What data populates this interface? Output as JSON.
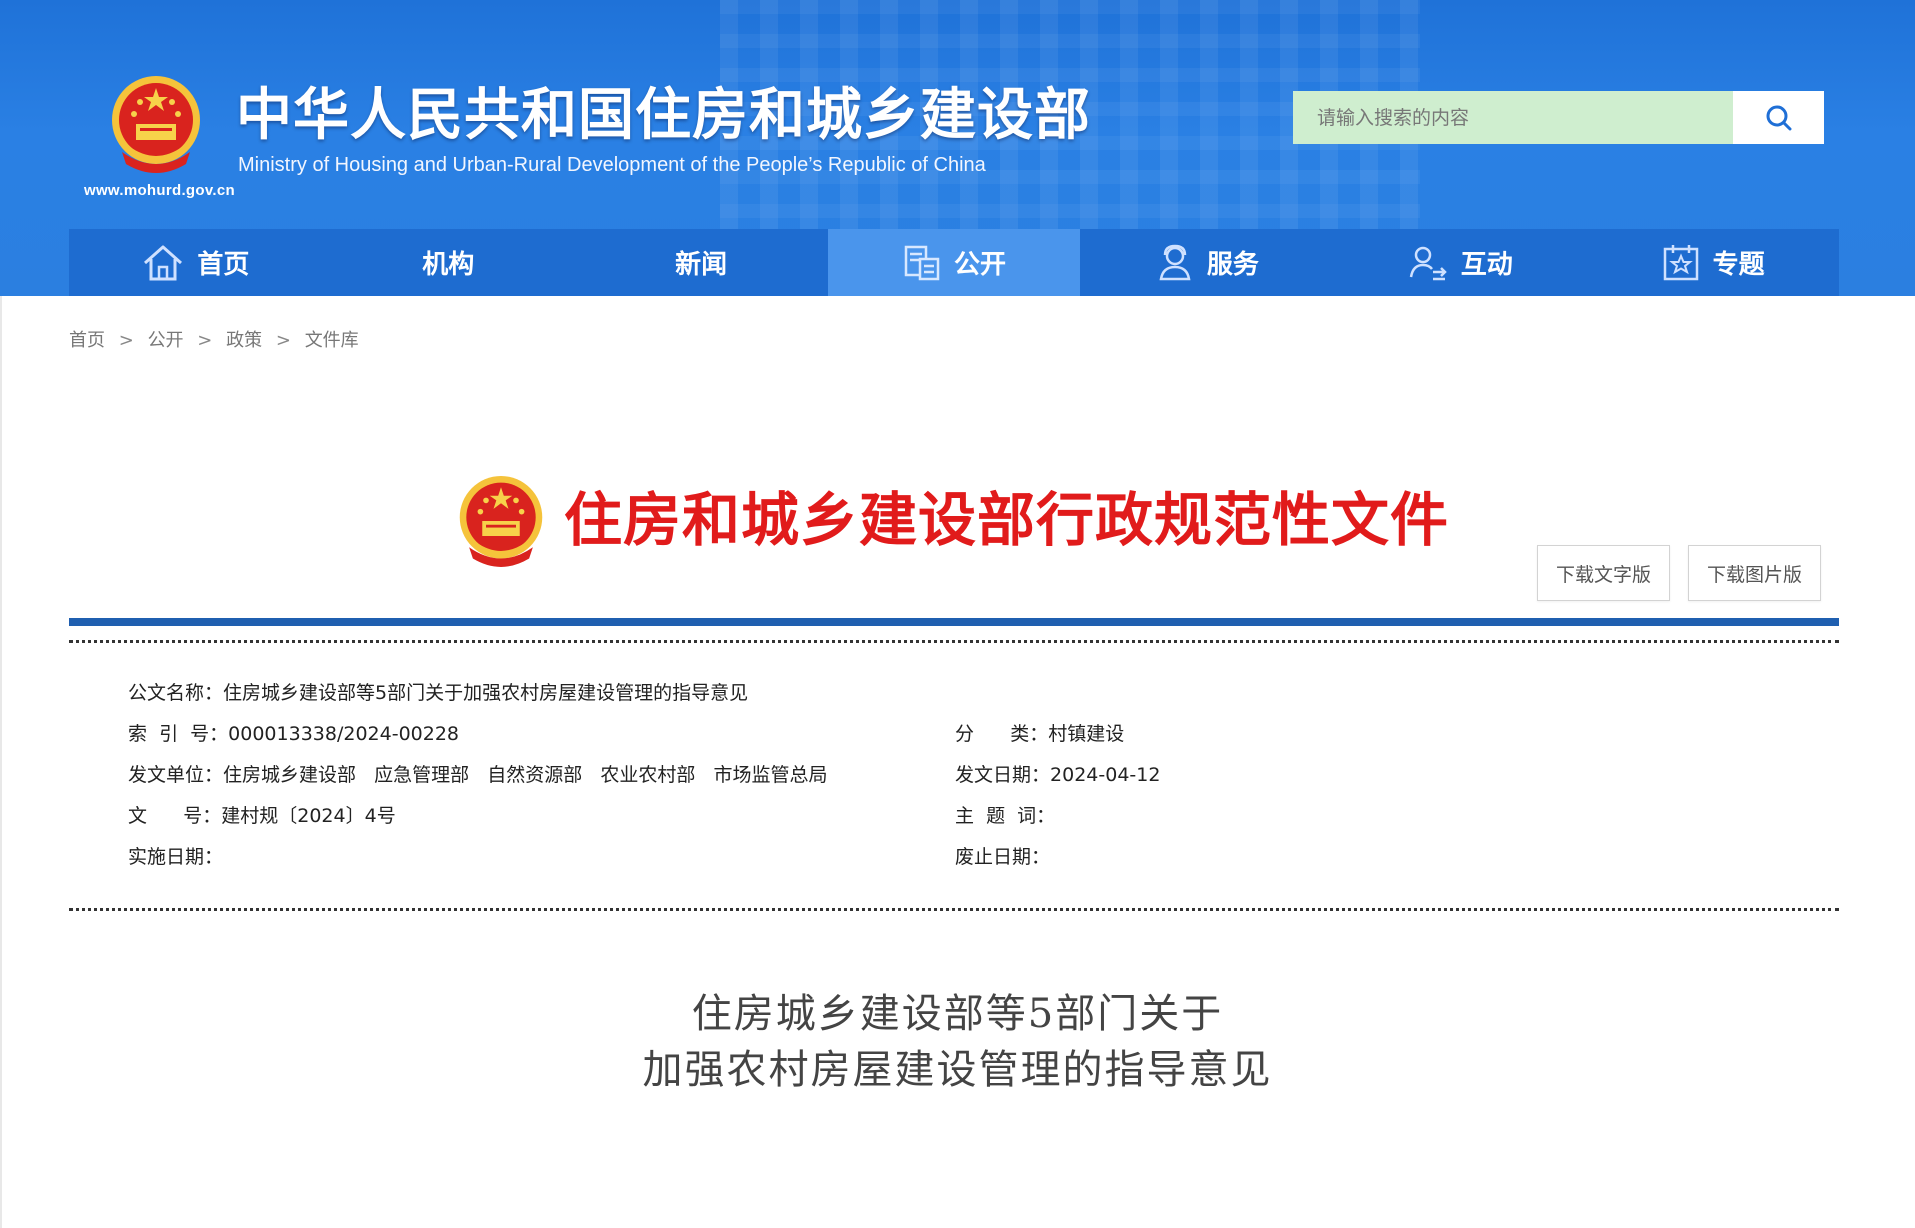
{
  "header": {
    "site_title": "中华人民共和国住房和城乡建设部",
    "site_subtitle": "Ministry of Housing and Urban-Rural Development of the People’s Republic of China",
    "site_url": "www.mohurd.gov.cn",
    "emblem_icon": "national-emblem-icon",
    "search": {
      "placeholder": "请输入搜索的内容",
      "value": "",
      "icon": "search-icon"
    },
    "colors": {
      "header_bg": "#2a80e4",
      "nav_bg": "#1e6cd0",
      "nav_active_bg": "#4a95ec",
      "search_bg": "#cfeecf"
    }
  },
  "nav": {
    "items": [
      {
        "label": "首页",
        "icon": "home-icon",
        "active": false
      },
      {
        "label": "机构",
        "icon": "",
        "active": false
      },
      {
        "label": "新闻",
        "icon": "",
        "active": false
      },
      {
        "label": "公开",
        "icon": "document-icon",
        "active": true
      },
      {
        "label": "服务",
        "icon": "user-service-icon",
        "active": false
      },
      {
        "label": "互动",
        "icon": "user-exchange-icon",
        "active": false
      },
      {
        "label": "专题",
        "icon": "star-box-icon",
        "active": false
      }
    ]
  },
  "breadcrumb": {
    "items": [
      "首页",
      "公开",
      "政策",
      "文件库"
    ],
    "separator": ">"
  },
  "doc_header": {
    "heading": "住房和城乡建设部行政规范性文件",
    "heading_color": "#e11b1b",
    "download_text": "下载文字版",
    "download_image": "下载图片版",
    "rule_color": "#1f5fb0"
  },
  "meta": {
    "title_label": "公文名称：",
    "title_value": "住房城乡建设部等5部门关于加强农村房屋建设管理的指导意见",
    "index_label": "索  引  号：",
    "index_value": "000013338/2024-00228",
    "category_label": "分      类：",
    "category_value": "村镇建设",
    "issuer_label": "发文单位：",
    "issuer_value": "住房城乡建设部   应急管理部   自然资源部   农业农村部   市场监管总局",
    "date_label": "发文日期：",
    "date_value": "2024-04-12",
    "docno_label": "文      号：",
    "docno_value": "建村规〔2024〕4号",
    "subject_label": "主  题  词：",
    "subject_value": "",
    "effective_label": "实施日期：",
    "effective_value": "",
    "expiry_label": "废止日期：",
    "expiry_value": ""
  },
  "body": {
    "title_line1": "住房城乡建设部等5部门关于",
    "title_line2": "加强农村房屋建设管理的指导意见"
  }
}
